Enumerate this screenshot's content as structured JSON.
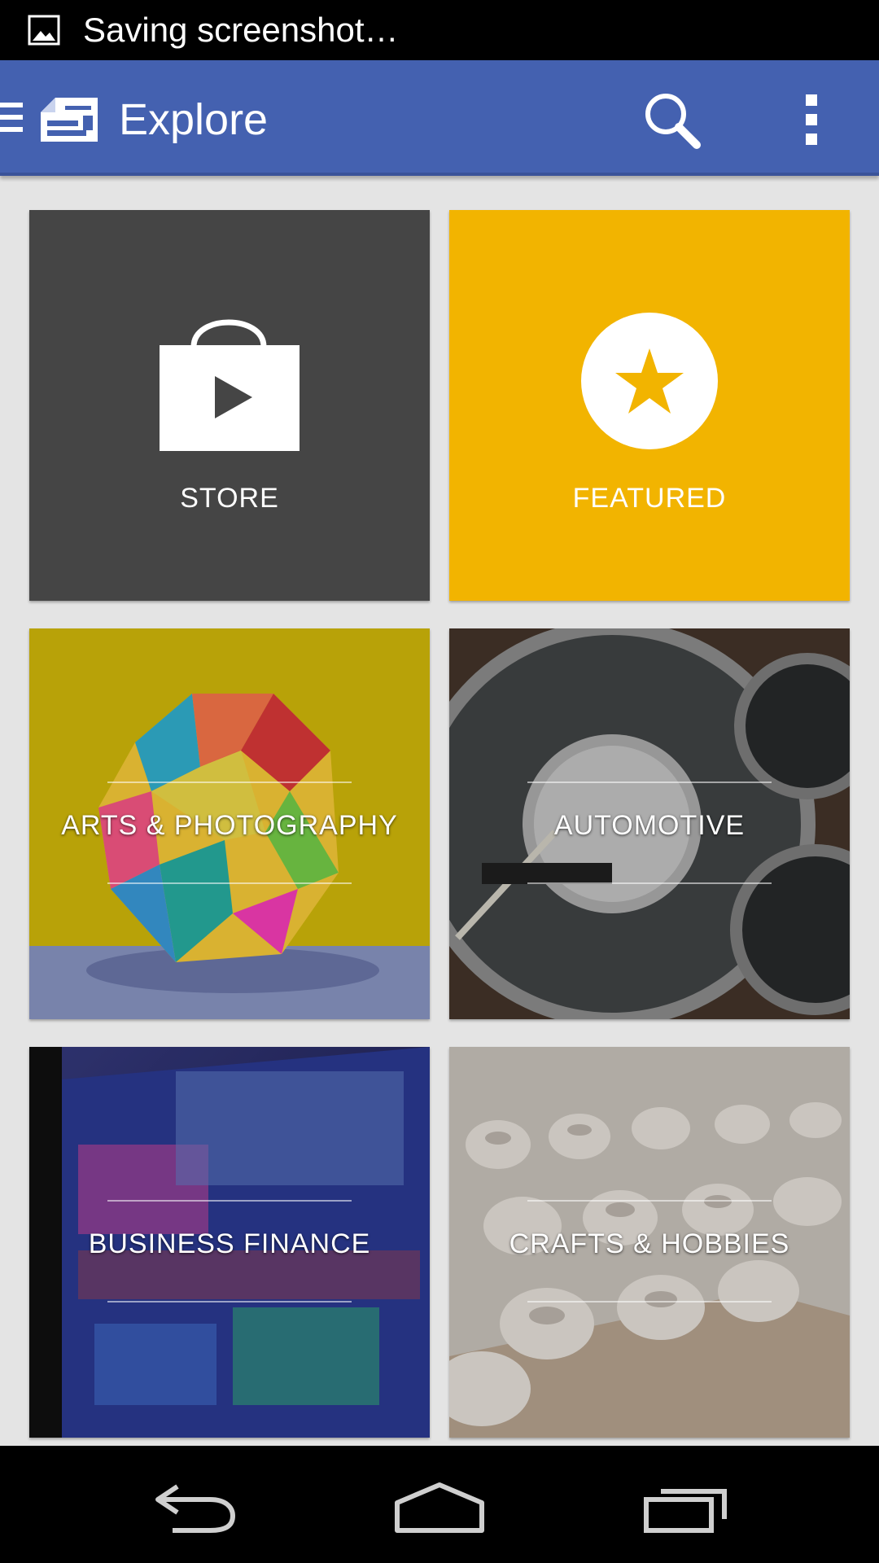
{
  "status_bar": {
    "notification_text": "Saving screenshot…",
    "icon": "image-icon"
  },
  "app_bar": {
    "title": "Explore",
    "background": "#4461b0",
    "icons": [
      "menu-icon",
      "app-logo-icon",
      "search-icon",
      "overflow-menu-icon"
    ]
  },
  "tiles": [
    {
      "label": "STORE",
      "kind": "icon",
      "icon": "shopping-bag-play-icon",
      "color": "#454545"
    },
    {
      "label": "FEATURED",
      "kind": "icon",
      "icon": "star-circle-icon",
      "color": "#f2b400"
    },
    {
      "label": "ARTS & PHOTOGRAPHY",
      "kind": "image",
      "image": "origami-photo"
    },
    {
      "label": "AUTOMOTIVE",
      "kind": "image",
      "image": "speedometer-photo"
    },
    {
      "label": "BUSINESS FINANCE",
      "kind": "image",
      "image": "stock-ticker-photo"
    },
    {
      "label": "CRAFTS & HOBBIES",
      "kind": "image",
      "image": "pottery-photo"
    }
  ],
  "nav_bar": {
    "icons": [
      "back-icon",
      "home-icon",
      "recents-icon"
    ]
  }
}
